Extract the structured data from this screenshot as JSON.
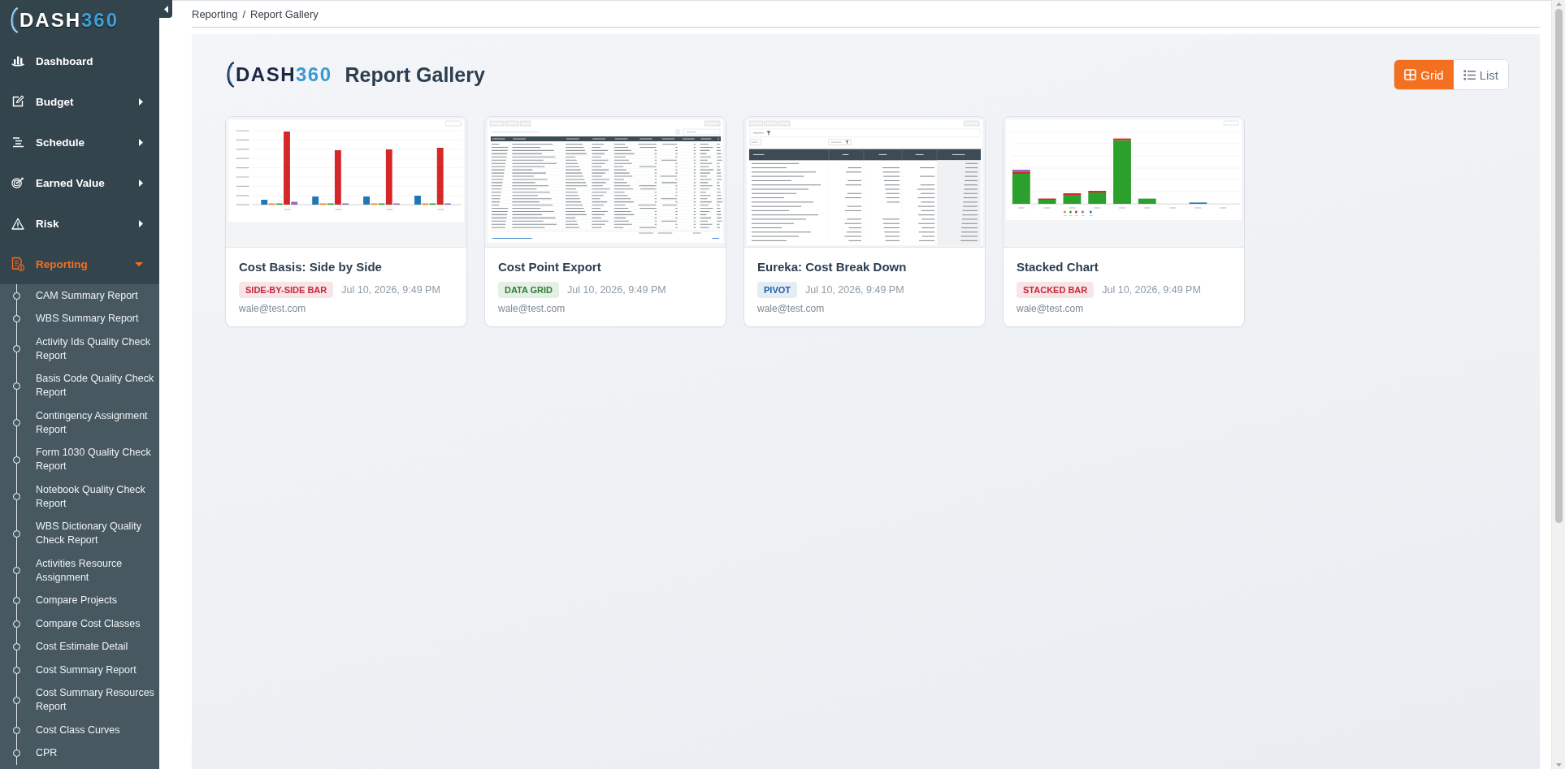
{
  "sidebar": {
    "logo": {
      "wordmark": [
        "DASH",
        "360"
      ]
    },
    "items": [
      {
        "label": "Dashboard",
        "kind": "link",
        "selected": false
      },
      {
        "label": "Budget",
        "kind": "group",
        "selected": false,
        "expanded": false
      },
      {
        "label": "Schedule",
        "kind": "group",
        "selected": false,
        "expanded": false
      },
      {
        "label": "Earned Value",
        "kind": "group",
        "selected": false,
        "expanded": false
      },
      {
        "label": "Risk",
        "kind": "group",
        "selected": false,
        "expanded": false
      },
      {
        "label": "Reporting",
        "kind": "group",
        "selected": true,
        "expanded": true,
        "children": [
          {
            "label": "CAM Summary Report",
            "selected": false
          },
          {
            "label": "WBS Summary Report",
            "selected": false
          },
          {
            "label": "Activity Ids Quality Check Report",
            "selected": false
          },
          {
            "label": "Basis Code Quality Check Report",
            "selected": false
          },
          {
            "label": "Contingency Assignment Report",
            "selected": false
          },
          {
            "label": "Form 1030 Quality Check Report",
            "selected": false
          },
          {
            "label": "Notebook Quality Check Report",
            "selected": false
          },
          {
            "label": "WBS Dictionary Quality Check Report",
            "selected": false
          },
          {
            "label": "Activities Resource Assignment",
            "selected": false
          },
          {
            "label": "Compare Projects",
            "selected": false
          },
          {
            "label": "Compare Cost Classes",
            "selected": false
          },
          {
            "label": "Cost Estimate Detail",
            "selected": false
          },
          {
            "label": "Cost Summary Report",
            "selected": false
          },
          {
            "label": "Cost Summary Resources Report",
            "selected": false
          },
          {
            "label": "Cost Class Curves",
            "selected": false
          },
          {
            "label": "CPR",
            "selected": false
          }
        ]
      }
    ]
  },
  "breadcrumb": {
    "items": [
      "Reporting",
      "Report Gallery"
    ],
    "separator": "/"
  },
  "gallery": {
    "logo": {
      "wordmark": [
        "DASH",
        "360"
      ]
    },
    "title": "Report Gallery",
    "view_toggle": [
      {
        "label": "Grid",
        "selected": true
      },
      {
        "label": "List",
        "selected": false
      }
    ],
    "reports": [
      {
        "title": "Cost Basis: Side by Side",
        "kind": "side_by_side_bar",
        "type": {
          "label": "SIDE-BY-SIDE BAR",
          "color": "#c62839"
        },
        "date": "Jul 10, 2026, 9:49 PM",
        "author": "wale@test.com"
      },
      {
        "title": "Cost Point Export",
        "kind": "data_grid",
        "type": {
          "label": "DATA GRID",
          "color": "#2e7d32"
        },
        "date": "Jul 10, 2026, 9:49 PM",
        "author": "wale@test.com"
      },
      {
        "title": "Eureka: Cost Break Down",
        "kind": "pivot",
        "type": {
          "label": "PIVOT",
          "color": "#1d5fa6"
        },
        "date": "Jul 10, 2026, 9:49 PM",
        "author": "wale@test.com"
      },
      {
        "title": "Stacked Chart",
        "kind": "stacked_bar",
        "type": {
          "label": "STACKED BAR",
          "color": "#c62839"
        },
        "date": "Jul 10, 2026, 9:49 PM",
        "author": "wale@test.com"
      }
    ]
  }
}
